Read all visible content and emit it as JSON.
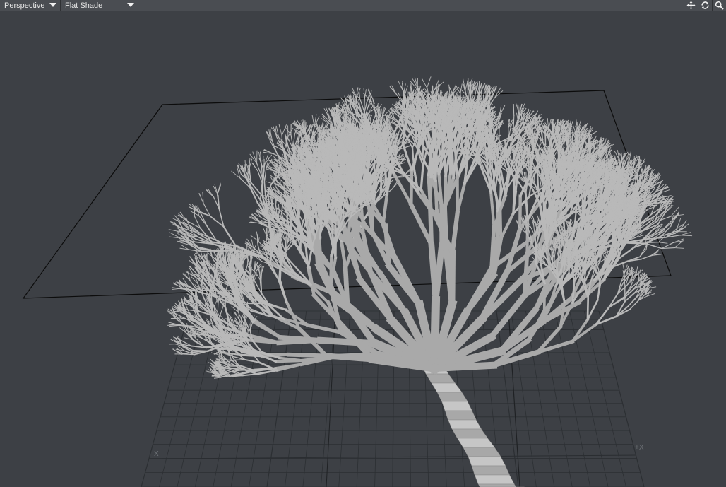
{
  "toolbar": {
    "view_dropdown": "Perspective",
    "shading_dropdown": "Flat Shade",
    "icons": [
      "move-icon",
      "rotate-icon",
      "zoom-icon"
    ]
  },
  "viewport": {
    "axis_neg_x": "X",
    "axis_pos_x": "+X"
  },
  "colors": {
    "background": "#3d4045",
    "toolbar": "#4a4d52",
    "grid": "#2c2f33",
    "branch": "#b9b9b9",
    "bounding_box": "#0c0c0c"
  }
}
